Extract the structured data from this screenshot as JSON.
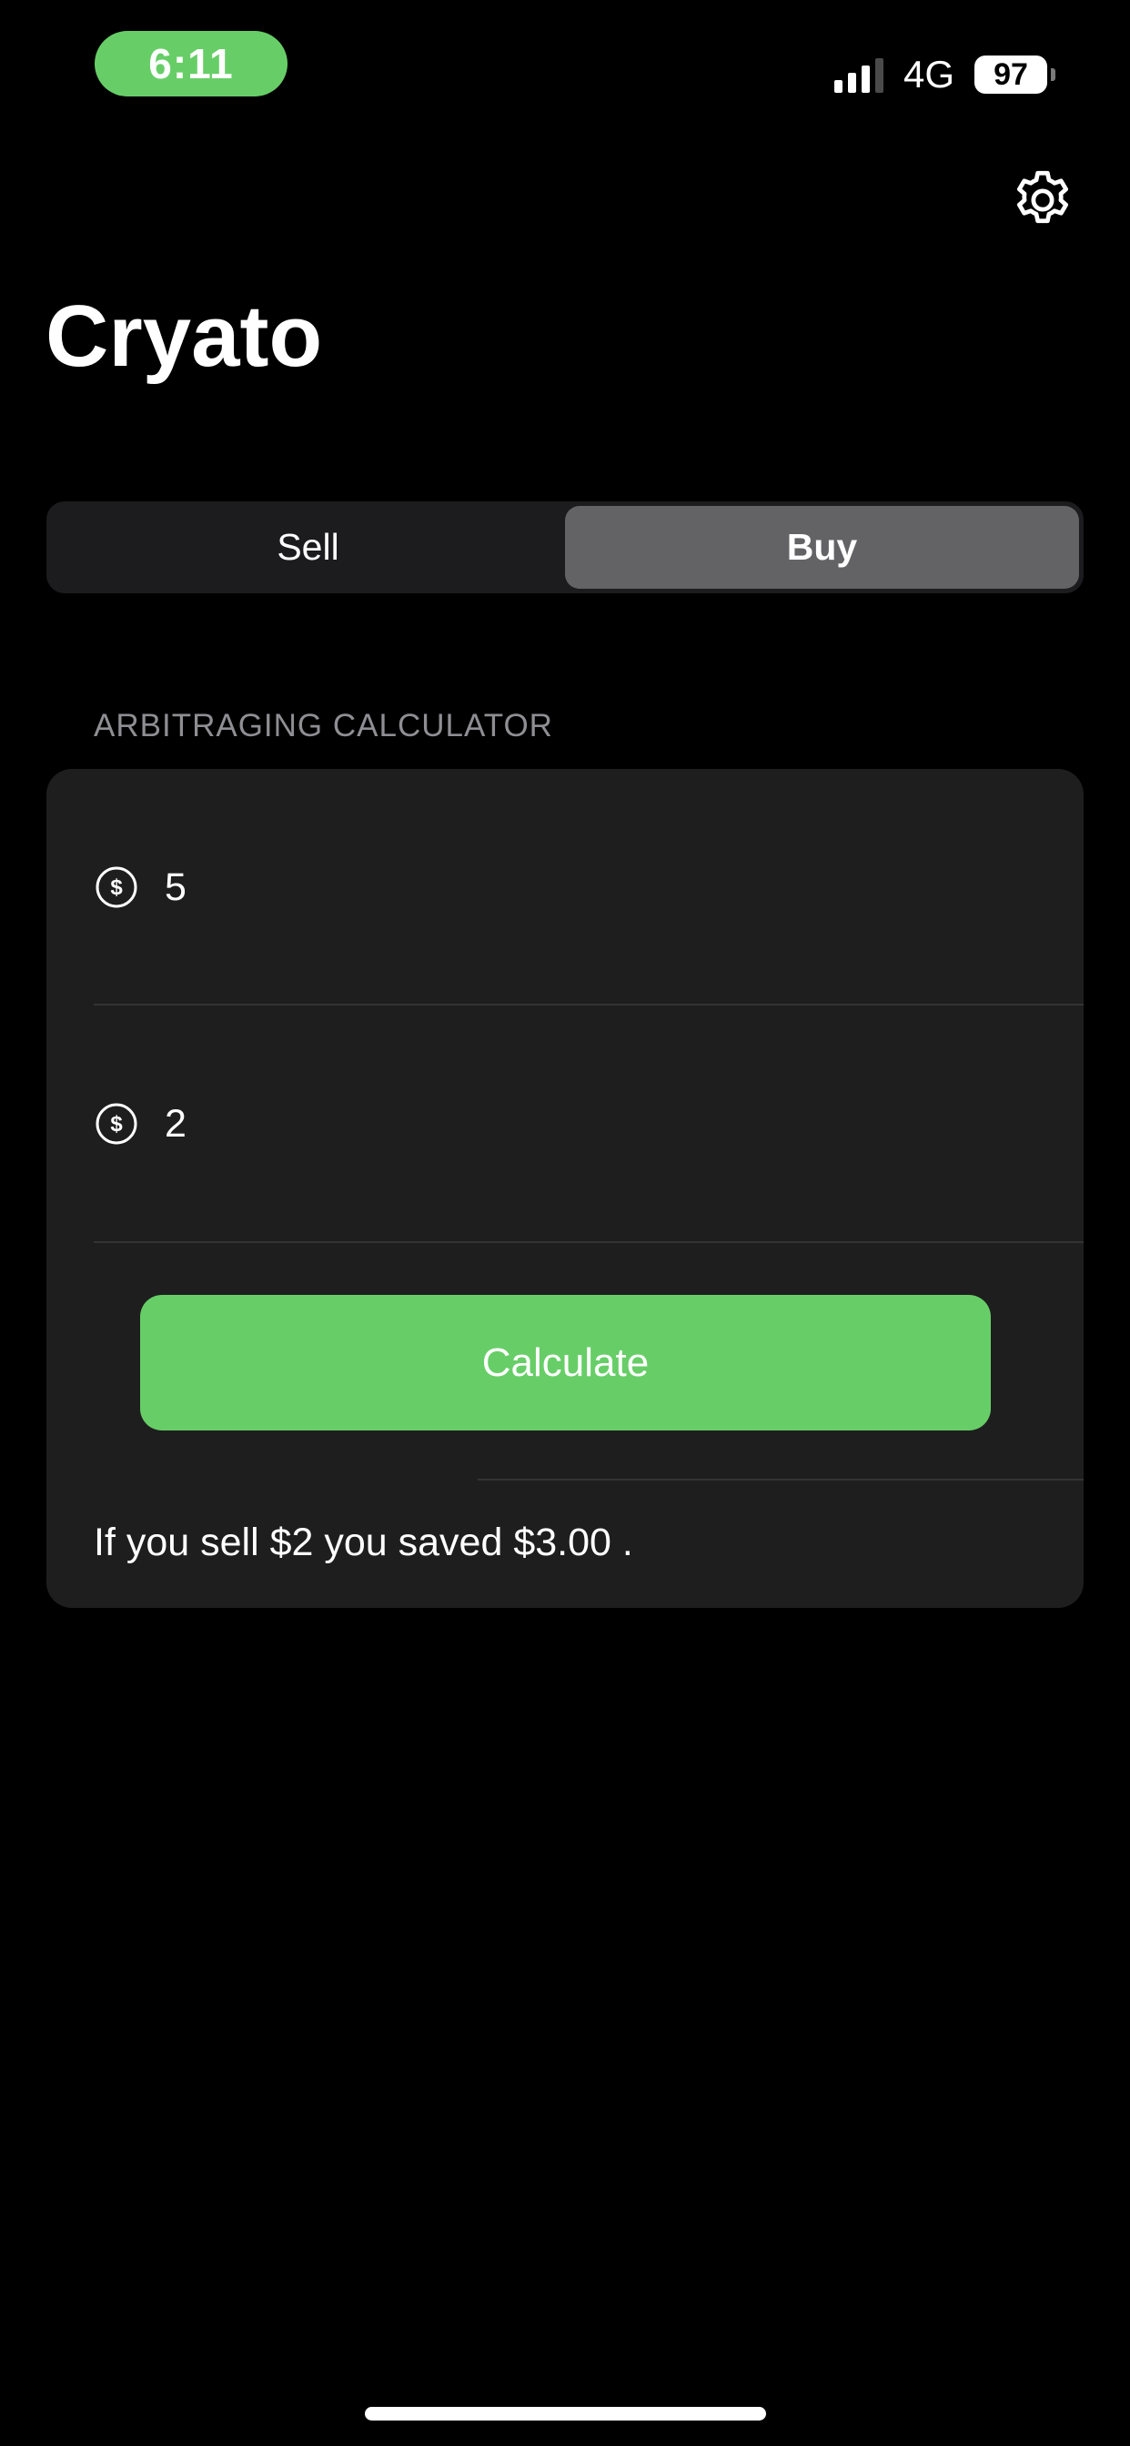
{
  "status_bar": {
    "time": "6:11",
    "network": "4G",
    "battery": "97",
    "accent_color": "#67ce67"
  },
  "header": {
    "settings_icon": "gear-icon",
    "title": "Cryato"
  },
  "segmented_control": {
    "segments": [
      {
        "label": "Sell",
        "selected": false
      },
      {
        "label": "Buy",
        "selected": true
      }
    ]
  },
  "calculator": {
    "section_header": "ARBITRAGING CALCULATOR",
    "fields": [
      {
        "icon": "dollar-circle-icon",
        "value": "5"
      },
      {
        "icon": "dollar-circle-icon",
        "value": "2"
      }
    ],
    "button_label": "Calculate",
    "button_color": "#67ce67",
    "result": "If you sell $2 you saved $3.00 ."
  }
}
